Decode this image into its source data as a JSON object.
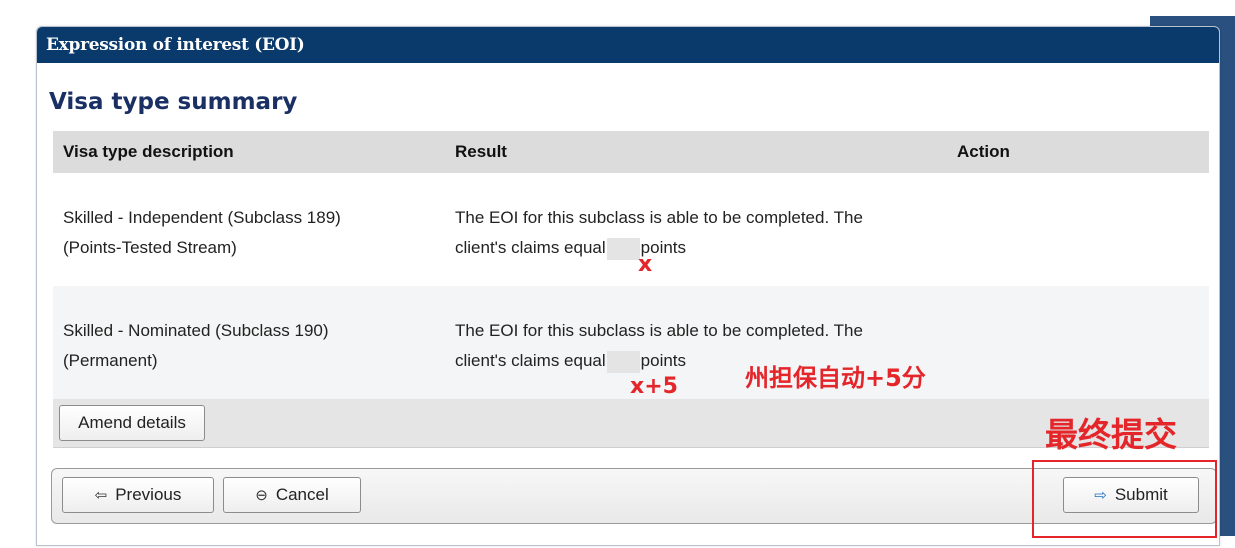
{
  "panel": {
    "title": "Expression of interest (EOI)",
    "section_title": "Visa type summary"
  },
  "table": {
    "headers": [
      "Visa type description",
      "Result",
      "Action"
    ],
    "rows": [
      {
        "description_line1": "Skilled - Independent (Subclass 189)",
        "description_line2": "(Points-Tested Stream)",
        "result_line1": "The EOI for this subclass is able to be completed. The",
        "result_line2_prefix": "client's claims equal",
        "result_line2_suffix": "points",
        "action": ""
      },
      {
        "description_line1": "Skilled - Nominated (Subclass 190)",
        "description_line2": "(Permanent)",
        "result_line1": "The EOI for this subclass is able to be completed. The",
        "result_line2_prefix": "client's claims equal",
        "result_line2_suffix": "points",
        "action": ""
      }
    ]
  },
  "buttons": {
    "amend": "Amend details",
    "previous": "Previous",
    "cancel": "Cancel",
    "submit": "Submit"
  },
  "icons": {
    "previous": "arrow-left-icon",
    "cancel": "minus-circle-icon",
    "submit": "arrow-right-icon"
  },
  "annotations": {
    "row1_points": "x",
    "row2_points": "x+5",
    "state_note": "州担保自动+5分",
    "final_submit": "最终提交"
  },
  "colors": {
    "header_bg": "#0a3a6b",
    "section_title": "#1a2f63",
    "annotation_red": "#e4262b",
    "submit_icon": "#1d6fc1"
  }
}
